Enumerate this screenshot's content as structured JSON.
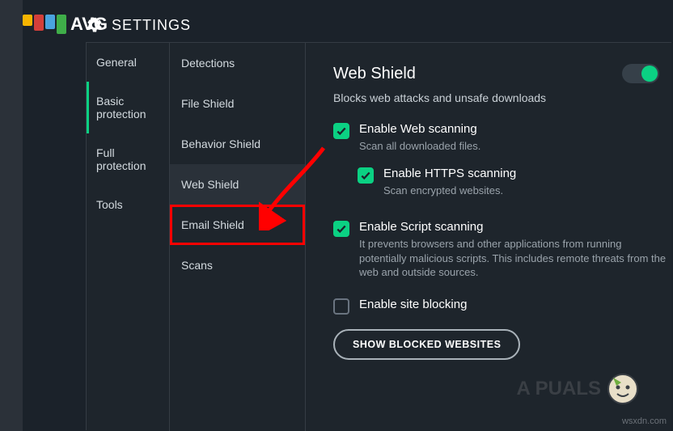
{
  "brand": {
    "name": "AVG",
    "logo_colors": [
      "#f7b500",
      "#d43f3a",
      "#4aa3df",
      "#3fae49"
    ]
  },
  "header": {
    "title": "SETTINGS"
  },
  "nav1": {
    "items": [
      {
        "label": "General"
      },
      {
        "label": "Basic protection"
      },
      {
        "label": "Full protection"
      },
      {
        "label": "Tools"
      }
    ]
  },
  "nav2": {
    "items": [
      {
        "label": "Detections"
      },
      {
        "label": "File Shield"
      },
      {
        "label": "Behavior Shield"
      },
      {
        "label": "Web Shield"
      },
      {
        "label": "Email Shield"
      },
      {
        "label": "Scans"
      }
    ]
  },
  "content": {
    "title": "Web Shield",
    "subtitle": "Blocks web attacks and unsafe downloads",
    "toggle_on": true,
    "options": {
      "web_scan": {
        "label": "Enable Web scanning",
        "desc": "Scan all downloaded files.",
        "checked": true
      },
      "https_scan": {
        "label": "Enable HTTPS scanning",
        "desc": "Scan encrypted websites.",
        "checked": true
      },
      "script_scan": {
        "label": "Enable Script scanning",
        "desc": "It prevents browsers and other applications from running potentially malicious scripts. This includes remote threats from the web and outside sources.",
        "checked": true
      },
      "site_block": {
        "label": "Enable site blocking",
        "checked": false
      }
    },
    "button": "SHOW BLOCKED WEBSITES"
  },
  "watermark": {
    "text": "A PUALS"
  },
  "credit": "wsxdn.com"
}
